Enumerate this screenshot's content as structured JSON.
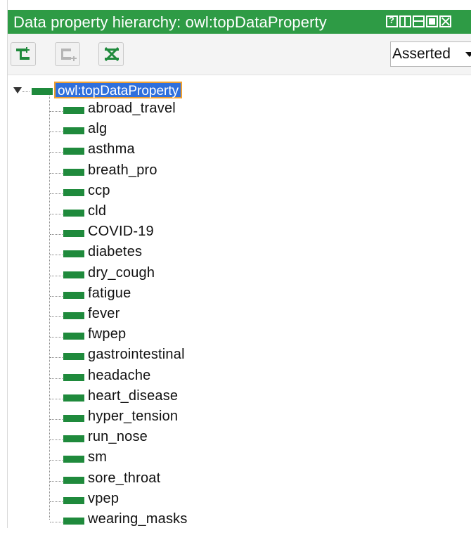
{
  "window": {
    "title": "Data property hierarchy: owl:topDataProperty"
  },
  "toolbar": {
    "buttons": [
      {
        "icon": "add-subproperty-icon",
        "enabled": true
      },
      {
        "icon": "add-sibling-property-icon",
        "enabled": false
      },
      {
        "icon": "delete-property-icon",
        "enabled": true
      }
    ],
    "view_select": "Asserted"
  },
  "tree": {
    "root": "owl:topDataProperty",
    "children": [
      "abroad_travel",
      "alg",
      "asthma",
      "breath_pro",
      "ccp",
      "cld",
      "COVID-19",
      "diabetes",
      "dry_cough",
      "fatigue",
      "fever",
      "fwpep",
      "gastrointestinal",
      "headache",
      "heart_disease",
      "hyper_tension",
      "run_nose",
      "sm",
      "sore_throat",
      "vpep",
      "wearing_masks"
    ]
  },
  "colors": {
    "accent": "#2e9b45",
    "property_bar": "#1f8a3c",
    "selection": "#2f6fdc",
    "selection_border": "#f0a030"
  }
}
